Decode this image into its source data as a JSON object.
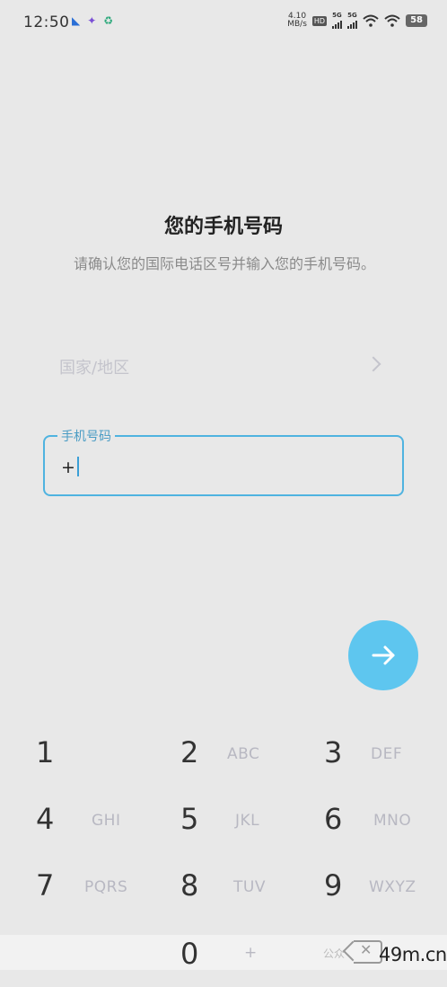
{
  "status_bar": {
    "time": "12:50",
    "net_speed_value": "4.10",
    "net_speed_unit": "MB/s",
    "hd_badge": "HD",
    "signal_1_label": "5G",
    "signal_2_label": "5G",
    "battery": "58",
    "left_icons": [
      "messenger-icon",
      "rocket-icon",
      "recycle-icon"
    ]
  },
  "page": {
    "title": "您的手机号码",
    "subtitle": "请确认您的国际电话区号并输入您的手机号码。"
  },
  "country": {
    "placeholder": "国家/地区"
  },
  "phone_field": {
    "label": "手机号码",
    "value": "+"
  },
  "next_button": {
    "icon": "arrow-right-icon",
    "color": "#5ec6ef"
  },
  "keypad": {
    "keys": [
      {
        "num": "1",
        "letters": ""
      },
      {
        "num": "2",
        "letters": "ABC"
      },
      {
        "num": "3",
        "letters": "DEF"
      },
      {
        "num": "4",
        "letters": "GHI"
      },
      {
        "num": "5",
        "letters": "JKL"
      },
      {
        "num": "6",
        "letters": "MNO"
      },
      {
        "num": "7",
        "letters": "PQRS"
      },
      {
        "num": "8",
        "letters": "TUV"
      },
      {
        "num": "9",
        "letters": "WXYZ"
      },
      {
        "num": "0",
        "letters": "+"
      }
    ]
  },
  "watermark": "公众",
  "brand": "49m.cn",
  "accent_color": "#4fb3e0"
}
